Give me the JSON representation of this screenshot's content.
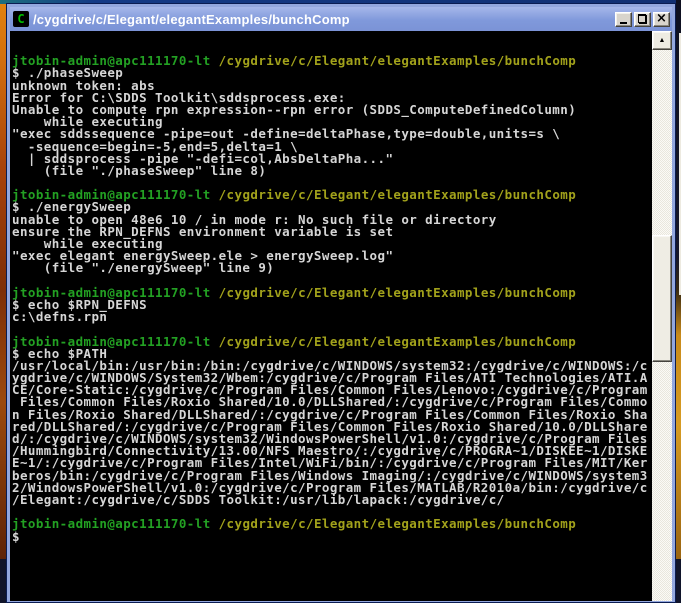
{
  "window": {
    "title": "/cygdrive/c/Elegant/elegantExamples/bunchComp",
    "icon_glyph": "C",
    "buttons": [
      {
        "name": "minimize"
      },
      {
        "name": "restore"
      },
      {
        "name": "close",
        "glyph": "×"
      }
    ]
  },
  "scrollbar": {
    "up_glyph": "▲"
  },
  "colors": {
    "console_bg": "#000000",
    "titlebar_blue": "#7E95D8",
    "map": {
      "g": "#23A123",
      "y": "#A2A21B",
      "w": "#D6D6D6"
    }
  },
  "terminal": {
    "prompt_user": "jtobin-admin@apc111170-lt",
    "prompt_path": "/cygdrive/c/Elegant/elegantExamples/bunchComp",
    "lines": [
      [],
      [
        [
          "g",
          "jtobin-admin@apc111170-lt"
        ],
        [
          "w",
          " "
        ],
        [
          "y",
          "/cygdrive/c/Elegant/elegantExamples/bunchComp"
        ]
      ],
      [
        [
          "w",
          "$ ./phaseSweep"
        ]
      ],
      [
        [
          "w",
          "unknown token: abs"
        ]
      ],
      [
        [
          "w",
          "Error for C:\\SDDS Toolkit\\sddsprocess.exe:"
        ]
      ],
      [
        [
          "w",
          "Unable to compute rpn expression--rpn error (SDDS_ComputeDefinedColumn)"
        ]
      ],
      [
        [
          "w",
          "    while executing"
        ]
      ],
      [
        [
          "w",
          "\"exec sddssequence -pipe=out -define=deltaPhase,type=double,units=s \\"
        ]
      ],
      [
        [
          "w",
          "  -sequence=begin=-5,end=5,delta=1 \\"
        ]
      ],
      [
        [
          "w",
          "  | sddsprocess -pipe \"-defi=col,AbsDeltaPha...\""
        ]
      ],
      [
        [
          "w",
          "    (file \"./phaseSweep\" line 8)"
        ]
      ],
      [],
      [
        [
          "g",
          "jtobin-admin@apc111170-lt"
        ],
        [
          "w",
          " "
        ],
        [
          "y",
          "/cygdrive/c/Elegant/elegantExamples/bunchComp"
        ]
      ],
      [
        [
          "w",
          "$ ./energySweep"
        ]
      ],
      [
        [
          "w",
          "unable to open 48e6 10 / in mode r: No such file or directory"
        ]
      ],
      [
        [
          "w",
          "ensure the RPN_DEFNS environment variable is set"
        ]
      ],
      [
        [
          "w",
          "    while executing"
        ]
      ],
      [
        [
          "w",
          "\"exec elegant energySweep.ele > energySweep.log\""
        ]
      ],
      [
        [
          "w",
          "    (file \"./energySweep\" line 9)"
        ]
      ],
      [],
      [
        [
          "g",
          "jtobin-admin@apc111170-lt"
        ],
        [
          "w",
          " "
        ],
        [
          "y",
          "/cygdrive/c/Elegant/elegantExamples/bunchComp"
        ]
      ],
      [
        [
          "w",
          "$ echo $RPN_DEFNS"
        ]
      ],
      [
        [
          "w",
          "c:\\defns.rpn"
        ]
      ],
      [],
      [
        [
          "g",
          "jtobin-admin@apc111170-lt"
        ],
        [
          "w",
          " "
        ],
        [
          "y",
          "/cygdrive/c/Elegant/elegantExamples/bunchComp"
        ]
      ],
      [
        [
          "w",
          "$ echo $PATH"
        ]
      ],
      [
        [
          "w",
          "/usr/local/bin:/usr/bin:/bin:/cygdrive/c/WINDOWS/system32:/cygdrive/c/WINDOWS:/c"
        ]
      ],
      [
        [
          "w",
          "ygdrive/c/WINDOWS/System32/Wbem:/cygdrive/c/Program Files/ATI Technologies/ATI.A"
        ]
      ],
      [
        [
          "w",
          "CE/Core-Static:/cygdrive/c/Program Files/Common Files/Lenovo:/cygdrive/c/Program"
        ]
      ],
      [
        [
          "w",
          " Files/Common Files/Roxio Shared/10.0/DLLShared/:/cygdrive/c/Program Files/Commo"
        ]
      ],
      [
        [
          "w",
          "n Files/Roxio Shared/DLLShared/:/cygdrive/c/Program Files/Common Files/Roxio Sha"
        ]
      ],
      [
        [
          "w",
          "red/DLLShared/:/cygdrive/c/Program Files/Common Files/Roxio Shared/10.0/DLLShare"
        ]
      ],
      [
        [
          "w",
          "d/:/cygdrive/c/WINDOWS/system32/WindowsPowerShell/v1.0:/cygdrive/c/Program Files"
        ]
      ],
      [
        [
          "w",
          "/Hummingbird/Connectivity/13.00/NFS Maestro/:/cygdrive/c/PROGRA~1/DISKEE~1/DISKE"
        ]
      ],
      [
        [
          "w",
          "E~1/:/cygdrive/c/Program Files/Intel/WiFi/bin/:/cygdrive/c/Program Files/MIT/Ker"
        ]
      ],
      [
        [
          "w",
          "beros/bin:/cygdrive/c/Program Files/Windows Imaging/:/cygdrive/c/WINDOWS/system3"
        ]
      ],
      [
        [
          "w",
          "2/WindowsPowerShell/v1.0:/cygdrive/c/Program Files/MATLAB/R2010a/bin:/cygdrive/c"
        ]
      ],
      [
        [
          "w",
          "/Elegant:/cygdrive/c/SDDS Toolkit:/usr/lib/lapack:/cygdrive/c/"
        ]
      ],
      [],
      [
        [
          "g",
          "jtobin-admin@apc111170-lt"
        ],
        [
          "w",
          " "
        ],
        [
          "y",
          "/cygdrive/c/Elegant/elegantExamples/bunchComp"
        ]
      ],
      [
        [
          "w",
          "$"
        ]
      ]
    ]
  }
}
